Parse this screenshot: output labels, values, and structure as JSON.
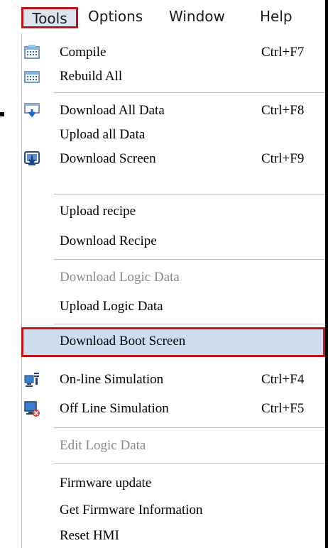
{
  "menubar": {
    "items": [
      {
        "label": "Tools"
      },
      {
        "label": "Options"
      },
      {
        "label": "Window"
      },
      {
        "label": "Help"
      }
    ],
    "active": "Tools"
  },
  "menu": {
    "items": [
      {
        "label": "Compile",
        "shortcut": "Ctrl+F7",
        "icon": "compile-icon",
        "enabled": true
      },
      {
        "label": "Rebuild All",
        "shortcut": "",
        "icon": "rebuild-icon",
        "enabled": true
      },
      {
        "label": "Download All Data",
        "shortcut": "Ctrl+F8",
        "icon": "download-data-icon",
        "enabled": true
      },
      {
        "label": "Upload all Data",
        "shortcut": "",
        "icon": "",
        "enabled": true
      },
      {
        "label": "Download Screen",
        "shortcut": "Ctrl+F9",
        "icon": "download-screen-icon",
        "enabled": true
      },
      {
        "label": "Upload recipe",
        "shortcut": "",
        "icon": "",
        "enabled": true
      },
      {
        "label": "Download Recipe",
        "shortcut": "",
        "icon": "",
        "enabled": true
      },
      {
        "label": "Download Logic Data",
        "shortcut": "",
        "icon": "",
        "enabled": false
      },
      {
        "label": "Upload Logic Data",
        "shortcut": "",
        "icon": "",
        "enabled": true
      },
      {
        "label": "Download Boot Screen",
        "shortcut": "",
        "icon": "",
        "enabled": true,
        "highlighted": true
      },
      {
        "label": "On-line Simulation",
        "shortcut": "Ctrl+F4",
        "icon": "online-simulation-icon",
        "enabled": true
      },
      {
        "label": "Off Line Simulation",
        "shortcut": "Ctrl+F5",
        "icon": "offline-simulation-icon",
        "enabled": true
      },
      {
        "label": "Edit Logic Data",
        "shortcut": "",
        "icon": "",
        "enabled": false
      },
      {
        "label": "Firmware update",
        "shortcut": "",
        "icon": "",
        "enabled": true
      },
      {
        "label": "Get Firmware Information",
        "shortcut": "",
        "icon": "",
        "enabled": true
      },
      {
        "label": "Reset HMI",
        "shortcut": "",
        "icon": "",
        "enabled": true
      }
    ]
  },
  "colors": {
    "highlight_border": "#c0141b",
    "highlight_fill": "#cfdcee",
    "disabled_text": "#8a8a8a"
  }
}
